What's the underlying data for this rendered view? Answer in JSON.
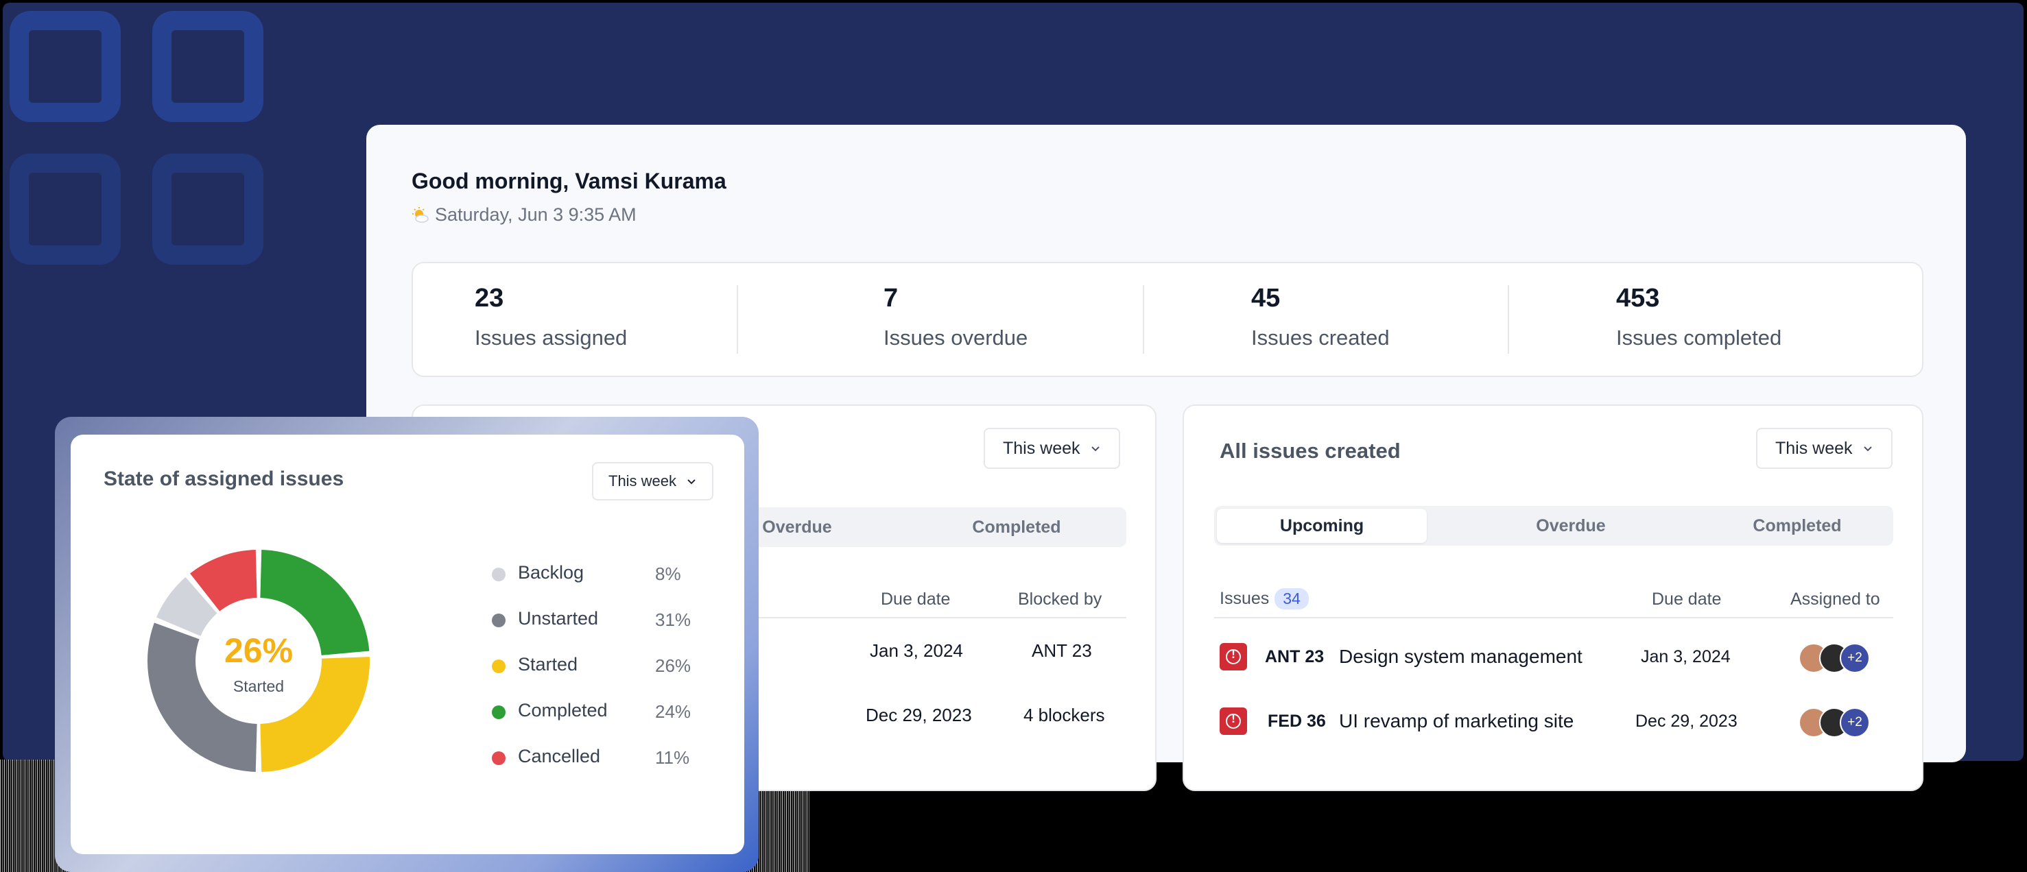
{
  "greeting": "Good morning, Vamsi Kurama",
  "datetime": "Saturday, Jun 3  9:35 AM",
  "stats": [
    {
      "value": "23",
      "label": "Issues assigned"
    },
    {
      "value": "7",
      "label": "Issues overdue"
    },
    {
      "value": "45",
      "label": "Issues created"
    },
    {
      "value": "453",
      "label": "Issues completed"
    }
  ],
  "left_card": {
    "dropdown": "This week",
    "tabs": [
      "Overdue",
      "Completed"
    ],
    "columns": [
      "Due date",
      "Blocked by"
    ],
    "rows": [
      {
        "due": "Jan 3, 2024",
        "blocked": "ANT 23"
      },
      {
        "due": "Dec 29, 2023",
        "blocked": "4 blockers"
      }
    ]
  },
  "right_card": {
    "title": "All issues created",
    "dropdown": "This week",
    "tabs": [
      "Upcoming",
      "Overdue",
      "Completed"
    ],
    "columns": {
      "issues": "Issues",
      "count": "34",
      "due": "Due date",
      "assigned": "Assigned to"
    },
    "rows": [
      {
        "id": "ANT 23",
        "title": "Design system management",
        "due": "Jan 3, 2024",
        "extra": "+2"
      },
      {
        "id": "FED 36",
        "title": "UI revamp of marketing site",
        "due": "Dec 29, 2023",
        "extra": "+2"
      }
    ]
  },
  "state_card": {
    "title": "State of assigned issues",
    "dropdown": "This week",
    "center_value": "26%",
    "center_label": "Started",
    "legend": [
      {
        "name": "Backlog",
        "pct": "8%",
        "color": "#d1d5db"
      },
      {
        "name": "Unstarted",
        "pct": "31%",
        "color": "#7b7f89"
      },
      {
        "name": "Started",
        "pct": "26%",
        "color": "#f5c518"
      },
      {
        "name": "Completed",
        "pct": "24%",
        "color": "#2e9e37"
      },
      {
        "name": "Cancelled",
        "pct": "11%",
        "color": "#e5484d"
      }
    ]
  },
  "chart_data": {
    "type": "pie",
    "title": "State of assigned issues",
    "categories": [
      "Completed",
      "Started",
      "Unstarted",
      "Backlog",
      "Cancelled"
    ],
    "values": [
      24,
      26,
      31,
      8,
      11
    ]
  }
}
